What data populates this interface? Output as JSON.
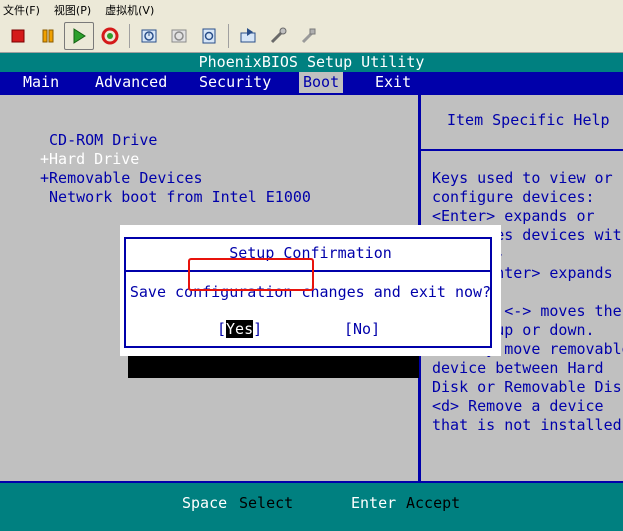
{
  "host_menu": [
    {
      "label": "文件(F)"
    },
    {
      "label": "视图(P)"
    },
    {
      "label": "虚拟机(V)"
    }
  ],
  "toolbar_icons": [
    "stop-icon",
    "pause-icon",
    "play-icon",
    "reset-icon",
    "snapshot-icon",
    "revert-snapshot-icon",
    "manage-snapshots-icon",
    "send-keys-icon",
    "settings-icon",
    "usb-icon"
  ],
  "bios": {
    "title": "PhoenixBIOS Setup Utility",
    "tabs": [
      {
        "label": "Main"
      },
      {
        "label": "Advanced"
      },
      {
        "label": "Security"
      },
      {
        "label": "Boot",
        "active": true
      },
      {
        "label": "Exit"
      }
    ],
    "boot_items": [
      {
        "label": " CD-ROM Drive"
      },
      {
        "label": "+Hard Drive"
      },
      {
        "label": "+Removable Devices"
      },
      {
        "label": " Network boot from Intel E1000"
      }
    ],
    "help_title": "Item Specific Help",
    "help_text": "Keys used to view or\nconfigure devices:\n<Enter> expands or\ncollapses devices with\na + or -\n<Ctrl+Enter> expands\nall\n<+> and <-> moves the\ndevice up or down.\n<n> May move removable\ndevice between Hard\nDisk or Removable Disk\n<d> Remove a device\nthat is not installed.",
    "status": [
      {
        "key": "Space",
        "desc": "Select"
      },
      {
        "key": "Enter",
        "desc": "Accept"
      }
    ]
  },
  "dialog": {
    "title": "Setup Confirmation",
    "message": "Save configuration changes and exit now?",
    "yes_open": "[",
    "yes_label": "Yes",
    "yes_close": "]",
    "no_label": "[No]"
  },
  "colors": {
    "bios_bg": "#c0c0c0",
    "bios_blue": "#0000aa",
    "bios_teal": "#008080",
    "highlight_red": "#e8130c"
  }
}
